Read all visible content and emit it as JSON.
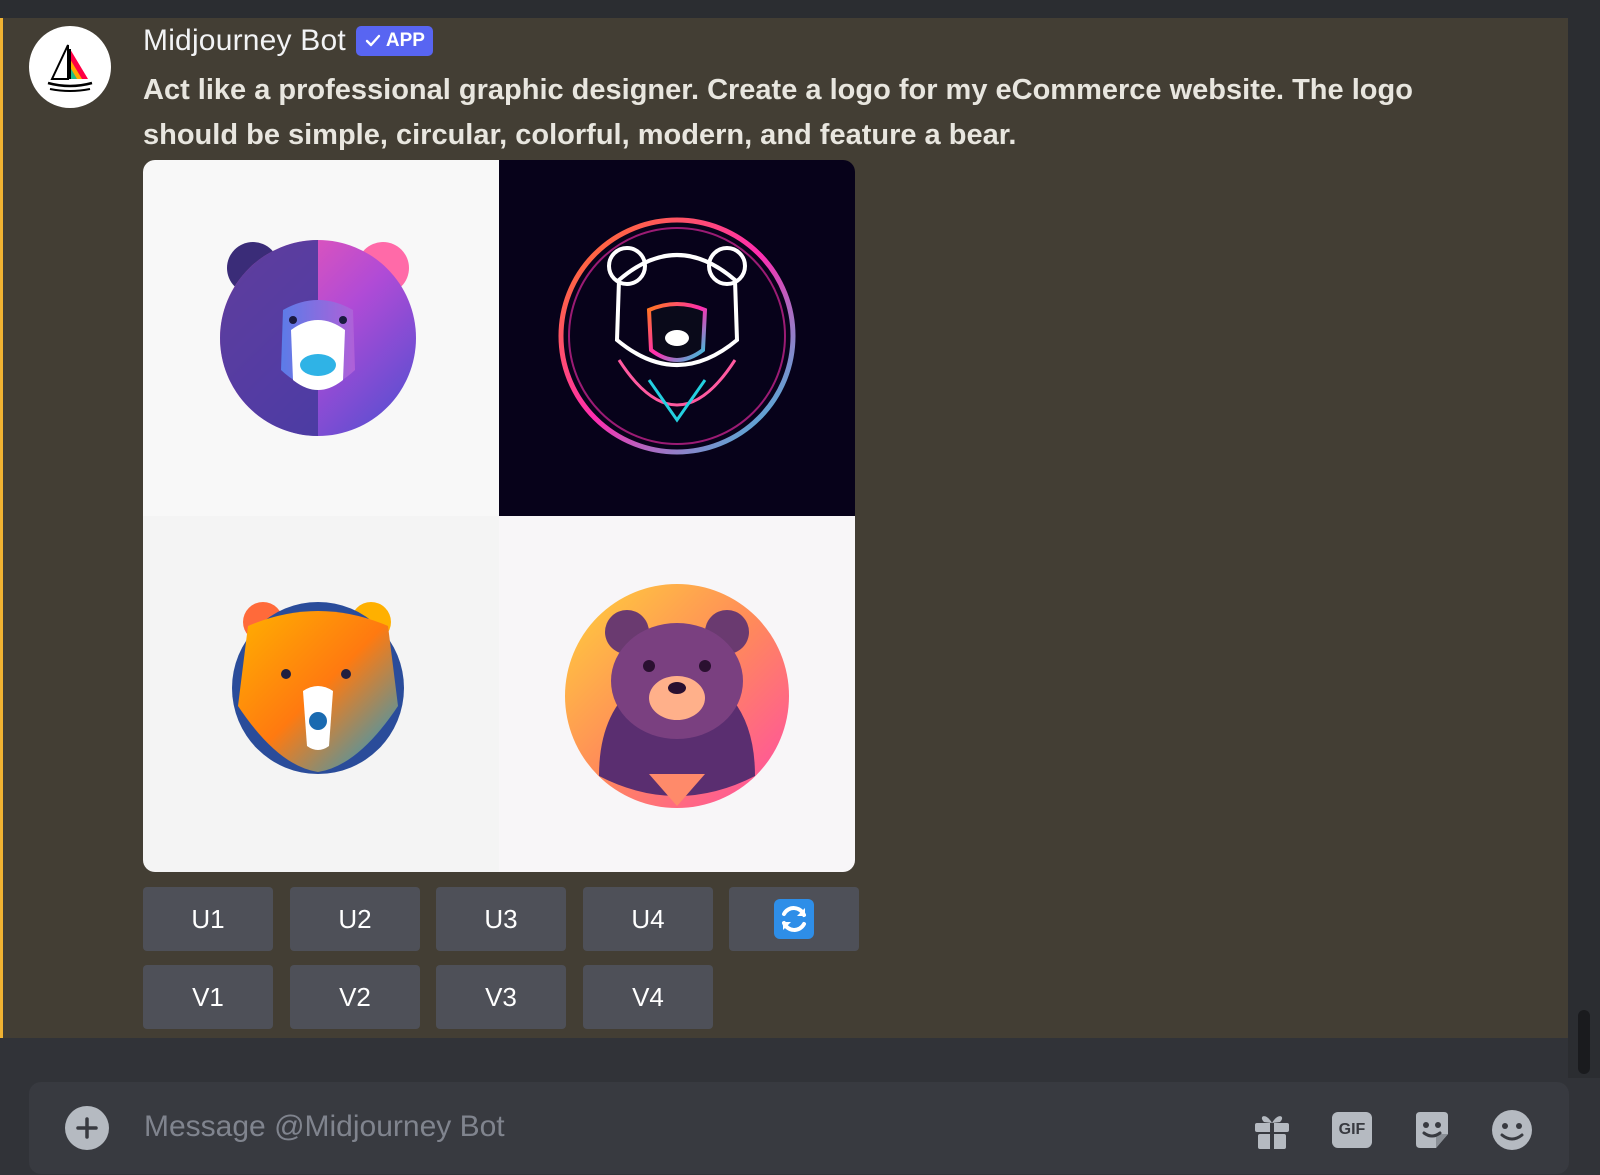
{
  "message": {
    "author": "Midjourney Bot",
    "badge": "APP",
    "text": "Act like a professional graphic designer. Create a logo for my eCommerce website. The logo should be simple, circular, colorful, modern, and feature a bear."
  },
  "buttons": {
    "upscale": [
      "U1",
      "U2",
      "U3",
      "U4"
    ],
    "variation": [
      "V1",
      "V2",
      "V3",
      "V4"
    ],
    "reroll_icon": "refresh-icon"
  },
  "composer": {
    "placeholder": "Message @Midjourney Bot",
    "gif_label": "GIF"
  },
  "colors": {
    "background": "#313338",
    "highlight": "#433e34",
    "accent_bar": "#f0b232",
    "badge": "#5865f2",
    "button": "#4e5058"
  }
}
